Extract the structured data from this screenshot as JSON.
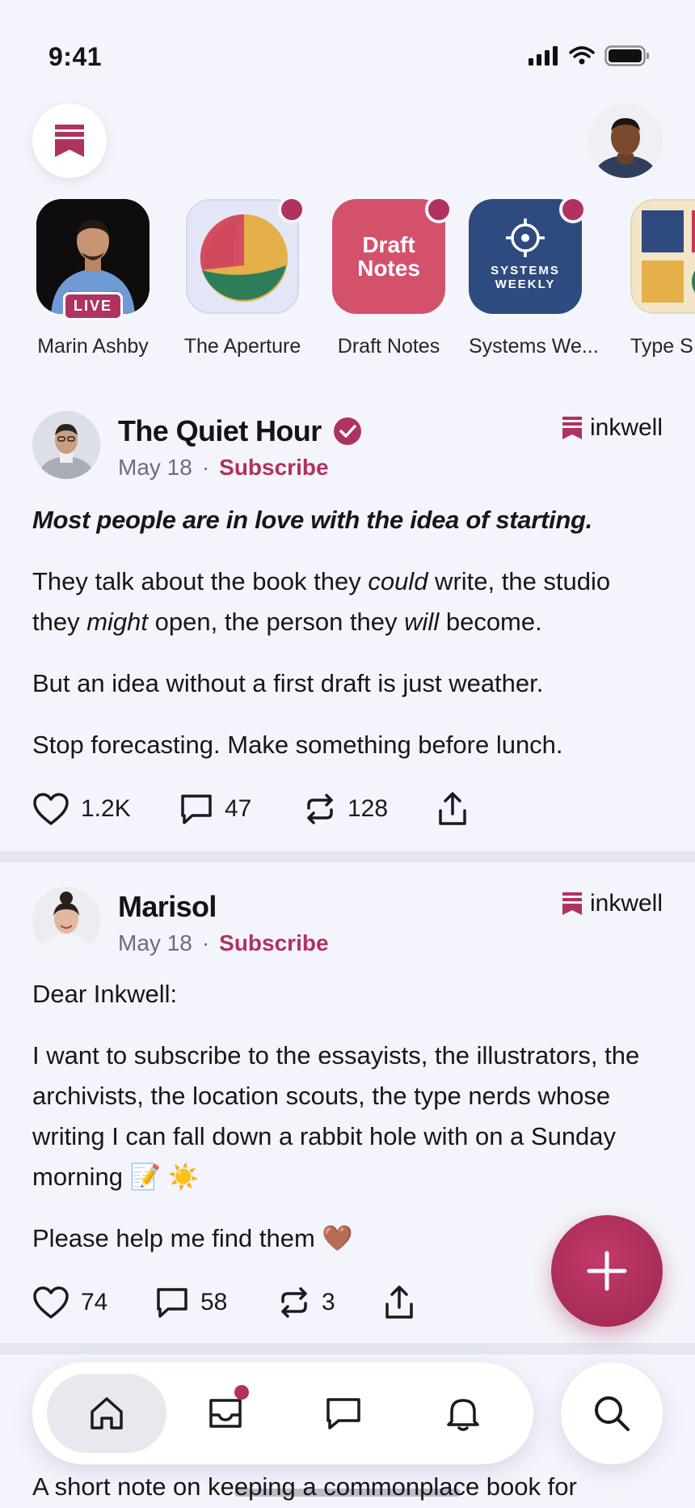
{
  "status_bar": {
    "time": "9:41"
  },
  "stories": [
    {
      "label": "Marin Ashby",
      "badge": "LIVE",
      "unread": false
    },
    {
      "label": "The Aperture",
      "unread": true
    },
    {
      "label": "Draft Notes",
      "tile_text": "Draft Notes",
      "unread": true
    },
    {
      "label": "Systems We...",
      "tile_text": "SYSTEMS WEEKLY",
      "unread": true
    },
    {
      "label": "Type S",
      "unread": false
    }
  ],
  "posts": [
    {
      "author": "The Quiet Hour",
      "verified": true,
      "date": "May 18",
      "separator": "·",
      "subscribe_label": "Subscribe",
      "source": "inkwell",
      "lead": "Most people are in love with the idea of starting.",
      "p1_a": "They talk about the book they ",
      "p1_b": "could",
      "p1_c": " write, the studio they ",
      "p1_d": "might",
      "p1_e": " open, the person they ",
      "p1_f": "will",
      "p1_g": " become.",
      "p2": "But an idea without a first draft is just weather.",
      "p3": "Stop forecasting. Make something before lunch.",
      "likes": "1.2K",
      "comments": "47",
      "restacks": "128"
    },
    {
      "author": "Marisol",
      "verified": false,
      "date": "May 18",
      "separator": "·",
      "subscribe_label": "Subscribe",
      "source": "inkwell",
      "p1": "Dear Inkwell:",
      "p2": "I want to subscribe to the essayists, the illustrators, the archivists, the location scouts, the type nerds whose writing I can fall down a rabbit hole with on a Sunday morning 📝 ☀️",
      "p3": "Please help me find them 🤎",
      "likes": "74",
      "comments": "58",
      "restacks": "3"
    }
  ],
  "peek": {
    "text": "A short note on keeping a commonplace book for"
  },
  "colors": {
    "accent": "#b0325e",
    "background": "#f4f5fc"
  }
}
